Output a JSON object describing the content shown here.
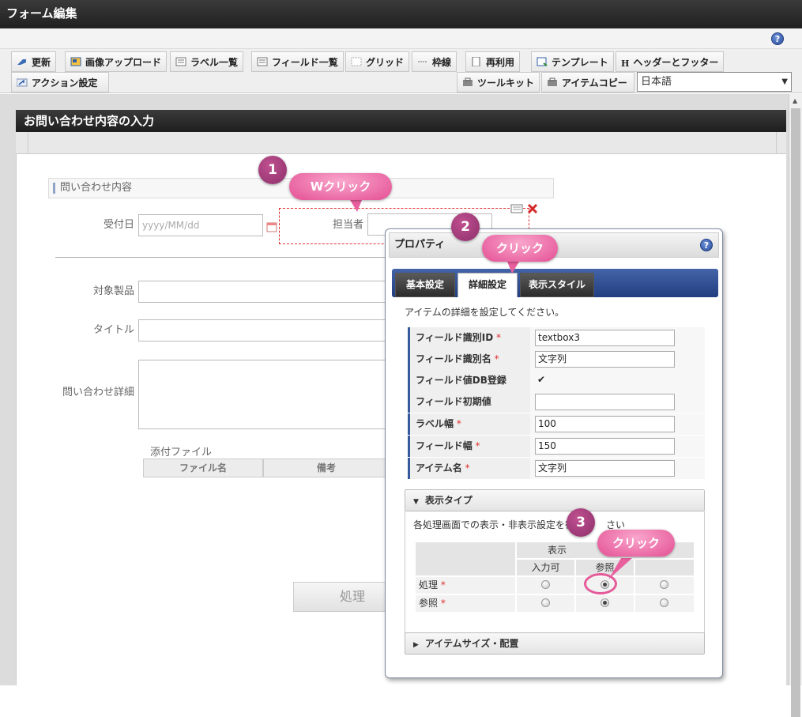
{
  "window": {
    "title": "フォーム編集"
  },
  "toolbar": {
    "row1": [
      {
        "name": "update-button",
        "label": "更新",
        "icon": "update-icon"
      },
      {
        "name": "image-upload-button",
        "label": "画像アップロード",
        "icon": "image-upload-icon"
      },
      {
        "name": "label-list-button",
        "label": "ラベル一覧",
        "icon": "list-icon"
      },
      {
        "name": "field-list-button",
        "label": "フィールド一覧",
        "icon": "list-icon"
      },
      {
        "name": "grid-button",
        "label": "グリッド",
        "icon": "grid-icon"
      },
      {
        "name": "frame-button",
        "label": "枠線",
        "icon": "frame-icon"
      },
      {
        "name": "reuse-button",
        "label": "再利用",
        "icon": "reuse-icon"
      },
      {
        "name": "template-button",
        "label": "テンプレート",
        "icon": "template-icon"
      },
      {
        "name": "header-footer-button",
        "label": "ヘッダーとフッター",
        "icon": "header-icon"
      }
    ],
    "action_label": "アクション設定",
    "toolkit_label": "ツールキット",
    "item_copy_label": "アイテムコピー",
    "language": "日本語"
  },
  "form": {
    "header": "お問い合わせ内容の入力",
    "section_title": "問い合わせ内容",
    "fields": {
      "reception_date_label": "受付日",
      "reception_date_placeholder": "yyyy/MM/dd",
      "person_label": "担当者",
      "product_label": "対象製品",
      "title_label": "タイトル",
      "detail_label": "問い合わせ詳細"
    },
    "attachments_label": "添付ファイル",
    "attach_columns": [
      "ファイル名",
      "備考"
    ],
    "process_button": "処理"
  },
  "properties": {
    "title": "プロパティ",
    "tabs": [
      "基本設定",
      "詳細設定",
      "表示スタイル"
    ],
    "active_tab": "詳細設定",
    "description": "アイテムの詳細を設定してください。",
    "rows": {
      "field_id_label": "フィールド識別ID",
      "field_id_value": "textbox3",
      "field_name_label": "フィールド識別名",
      "field_name_value": "文字列",
      "db_label": "フィールド値DB登録",
      "db_checked": true,
      "initial_label": "フィールド初期値",
      "initial_value": "",
      "label_width_label": "ラベル幅",
      "label_width_value": "100",
      "field_width_label": "フィールド幅",
      "field_width_value": "150",
      "item_name_label": "アイテム名",
      "item_name_value": "文字列"
    },
    "display_type": {
      "title": "表示タイプ",
      "description_start": "各処理画面での表示・非表示設定を行",
      "description_end": "さい",
      "header_group": "表示",
      "header_group_tail": "表",
      "col_input": "入力可",
      "col_ref": "参照",
      "row_process": "処理",
      "row_ref": "参照"
    },
    "size_section": "アイテムサイズ・配置"
  },
  "annotations": {
    "step1_num": "1",
    "step1_text": "Wクリック",
    "step2_num": "2",
    "step2_text": "クリック",
    "step3_num": "3",
    "step3_text": "クリック"
  }
}
